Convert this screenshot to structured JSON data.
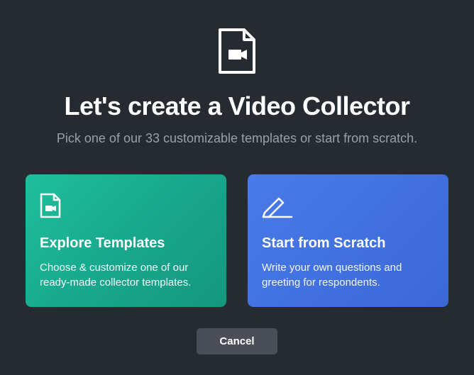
{
  "header": {
    "title": "Let's create a Video Collector",
    "subtitle": "Pick one of our 33 customizable templates or start from scratch."
  },
  "cards": {
    "templates": {
      "title": "Explore Templates",
      "description": "Choose & customize one of our ready-made collector templates."
    },
    "scratch": {
      "title": "Start from Scratch",
      "description": "Write your own questions and greeting for respondents."
    }
  },
  "actions": {
    "cancel": "Cancel"
  }
}
